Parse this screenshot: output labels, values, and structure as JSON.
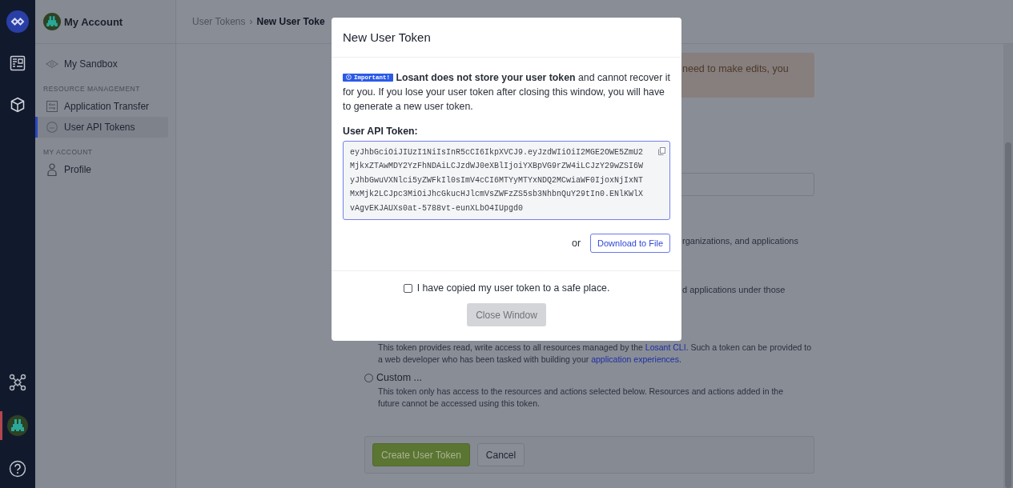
{
  "rail": {
    "top": [
      {
        "kind": "logo",
        "selected": false
      },
      {
        "kind": "dashboard",
        "selected": false
      },
      {
        "kind": "cube",
        "selected": false
      }
    ],
    "bottom": [
      {
        "kind": "network",
        "selected": false
      },
      {
        "kind": "avatar",
        "selected": true
      },
      {
        "kind": "help",
        "selected": false
      }
    ]
  },
  "sidebar": {
    "title": "My Account",
    "items": [
      {
        "kind": "item",
        "label": "My Sandbox",
        "selected": false
      },
      {
        "kind": "section",
        "label": "RESOURCE MANAGEMENT"
      },
      {
        "kind": "item",
        "label": "Application Transfer",
        "selected": false
      },
      {
        "kind": "item",
        "label": "User API Tokens",
        "selected": true
      },
      {
        "kind": "section",
        "label": "MY ACCOUNT"
      },
      {
        "kind": "item",
        "label": "Profile",
        "selected": false
      }
    ]
  },
  "breadcrumb": [
    "User Tokens",
    "›",
    "New User Toke"
  ],
  "page": {
    "warning_fragment": "need to make edits, you",
    "fragments": [
      "rganizations, and applications",
      "d applications under those"
    ],
    "cli_paragraph": {
      "before": "This token provides read, write access to all resources managed by the ",
      "link": "Losant CLI",
      "middle": ". Such a token can be provided to a web developer who has been tasked with building your ",
      "link2": "application experiences",
      "after": "."
    },
    "custom_option": {
      "label": "Custom ...",
      "selected": false,
      "description": "This token only has access to the resources and actions selected below. Resources and actions added in the future cannot be accessed using this token."
    },
    "buttons": [
      {
        "kind": "primary",
        "label": "Create User Token"
      },
      {
        "kind": "secondary",
        "label": "Cancel"
      }
    ]
  },
  "modal": {
    "title": "New User Token",
    "badge": "Important!",
    "notice": "**Losant does not store your user token** and cannot recover it for you. If you lose your user token after closing this window, you will have to generate a new user token.",
    "token_label": "User API Token:",
    "token": "eyJhbGciOiJIUzI1NiIsInR5cCI6IkpXVCJ9.eyJzdWIiOiI2MGE2OWE5ZmU2MjkxZTAwMDY2YzFhNDAiLCJzdWJ0eXBlIjoiYXBpVG9rZW4iLCJzY29wZSI6WyJhbGwuVXNlci5yZWFkIl0sImV4cCI6MTYyMTYxNDQ2MCwiaWF0IjoxNjIxNTMxMjk2LCJpc3MiOiJhcGkucHJlcmVsZWFzZS5sb3NhbnQuY29tIn0.ENlKWlXvAgvEKJAUXs0at-5788vt-eunXLbO4IUpgd0",
    "or_text": "or",
    "download_button": "Download to File",
    "checkbox": {
      "label": "I have copied my user token to a safe place.",
      "checked": false
    },
    "close_button": {
      "label": "Close Window",
      "disabled": true
    }
  }
}
